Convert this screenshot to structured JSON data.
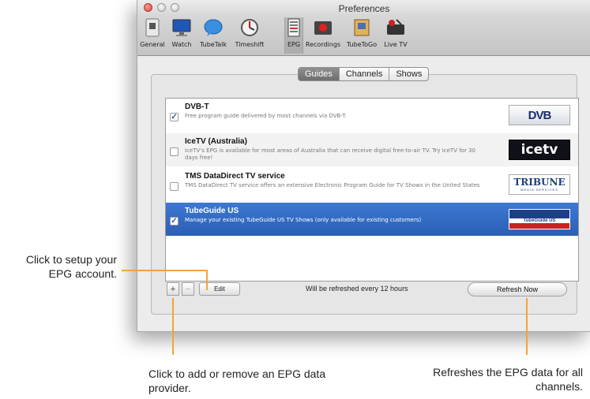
{
  "window": {
    "title": "Preferences"
  },
  "toolbar": {
    "items": [
      {
        "label": "General",
        "icon": "general-icon"
      },
      {
        "label": "Watch",
        "icon": "monitor-icon"
      },
      {
        "label": "TubeTalk",
        "icon": "speech-bubble-icon"
      },
      {
        "label": "Timeshift",
        "icon": "timeshift-icon"
      },
      {
        "label": "EPG",
        "icon": "epg-icon"
      },
      {
        "label": "Recordings",
        "icon": "record-icon"
      },
      {
        "label": "TubeToGo",
        "icon": "tubetogo-icon"
      },
      {
        "label": "Live TV",
        "icon": "live-tv-icon"
      }
    ],
    "selected": "EPG"
  },
  "tabs": [
    "Guides",
    "Channels",
    "Shows"
  ],
  "active_tab": "Guides",
  "guides": [
    {
      "title": "DVB-T",
      "description": "Free program guide delivered by most channels via DVB-T.",
      "checked": true,
      "logo": "DVB"
    },
    {
      "title": "IceTV (Australia)",
      "description": "IceTV's EPG is available for most areas of Australia that can receive digital free-to-air TV. Try IceTV for 30 days free!",
      "checked": false,
      "logo": "icetv"
    },
    {
      "title": "TMS DataDirect TV service",
      "description": "TMS DataDirect TV service offers an extensive Electronic Program Guide for TV Shows in the United States",
      "checked": false,
      "logo": "TRIBUNE",
      "logo_sub": "MEDIA SERVICES"
    },
    {
      "title": "TubeGuide US",
      "description": "Manage your existing TubeGuide US TV Shows (only available for existing customers)",
      "checked": true,
      "logo": "TubeGuide US"
    }
  ],
  "bottom": {
    "add": "+",
    "remove": "−",
    "edit": "Edit",
    "refresh_info": "Will be refreshed every 12 hours",
    "refresh_button": "Refresh Now"
  },
  "annotations": {
    "setup": "Click to setup your EPG account.",
    "add_remove": "Click to add or remove an EPG data provider.",
    "refresh": "Refreshes the EPG data for all channels."
  },
  "colors": {
    "accent_line": "#f4a23a",
    "selection": "#2f66bf"
  }
}
